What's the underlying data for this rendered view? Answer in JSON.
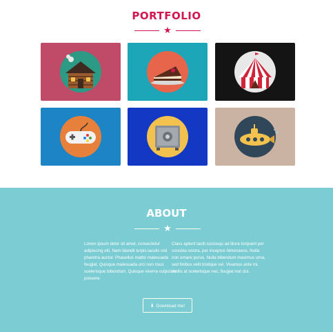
{
  "colors": {
    "accent": "#d0154f",
    "about_bg": "#7ccdd3",
    "tiles": [
      "#c04b68",
      "#1da5b8",
      "#141414",
      "#1d84c6",
      "#1238c4",
      "#cbb3a4"
    ]
  },
  "portfolio": {
    "title": "PORTFOLIO",
    "items": [
      {
        "icon": "log-cabin-icon"
      },
      {
        "icon": "cake-icon"
      },
      {
        "icon": "circus-tent-icon"
      },
      {
        "icon": "game-controller-icon"
      },
      {
        "icon": "safe-icon"
      },
      {
        "icon": "submarine-icon"
      }
    ]
  },
  "about": {
    "title": "ABOUT",
    "col1": "Lorem ipsum dolor sit amet, consectetur adipiscing elit. Nam blandit turpis iaculis nisl pharetra auctor. Phasellus mattis malesuada feugiat. Quisque malesuada orci non risus scelerisque bibendum. Quisque viverra vulputate posuere.",
    "col2": "Class aptent taciti sociosqu ad litora torquent per conubia nostra, per inceptos himenaeos. Nulla non ornare purus. Nulla bibendum maximus urna, sed finibus velit tristique vel. Vivamus ante mi, mollis at scelerisque nec, feugiat non dui.",
    "download_label": "Download me!"
  }
}
